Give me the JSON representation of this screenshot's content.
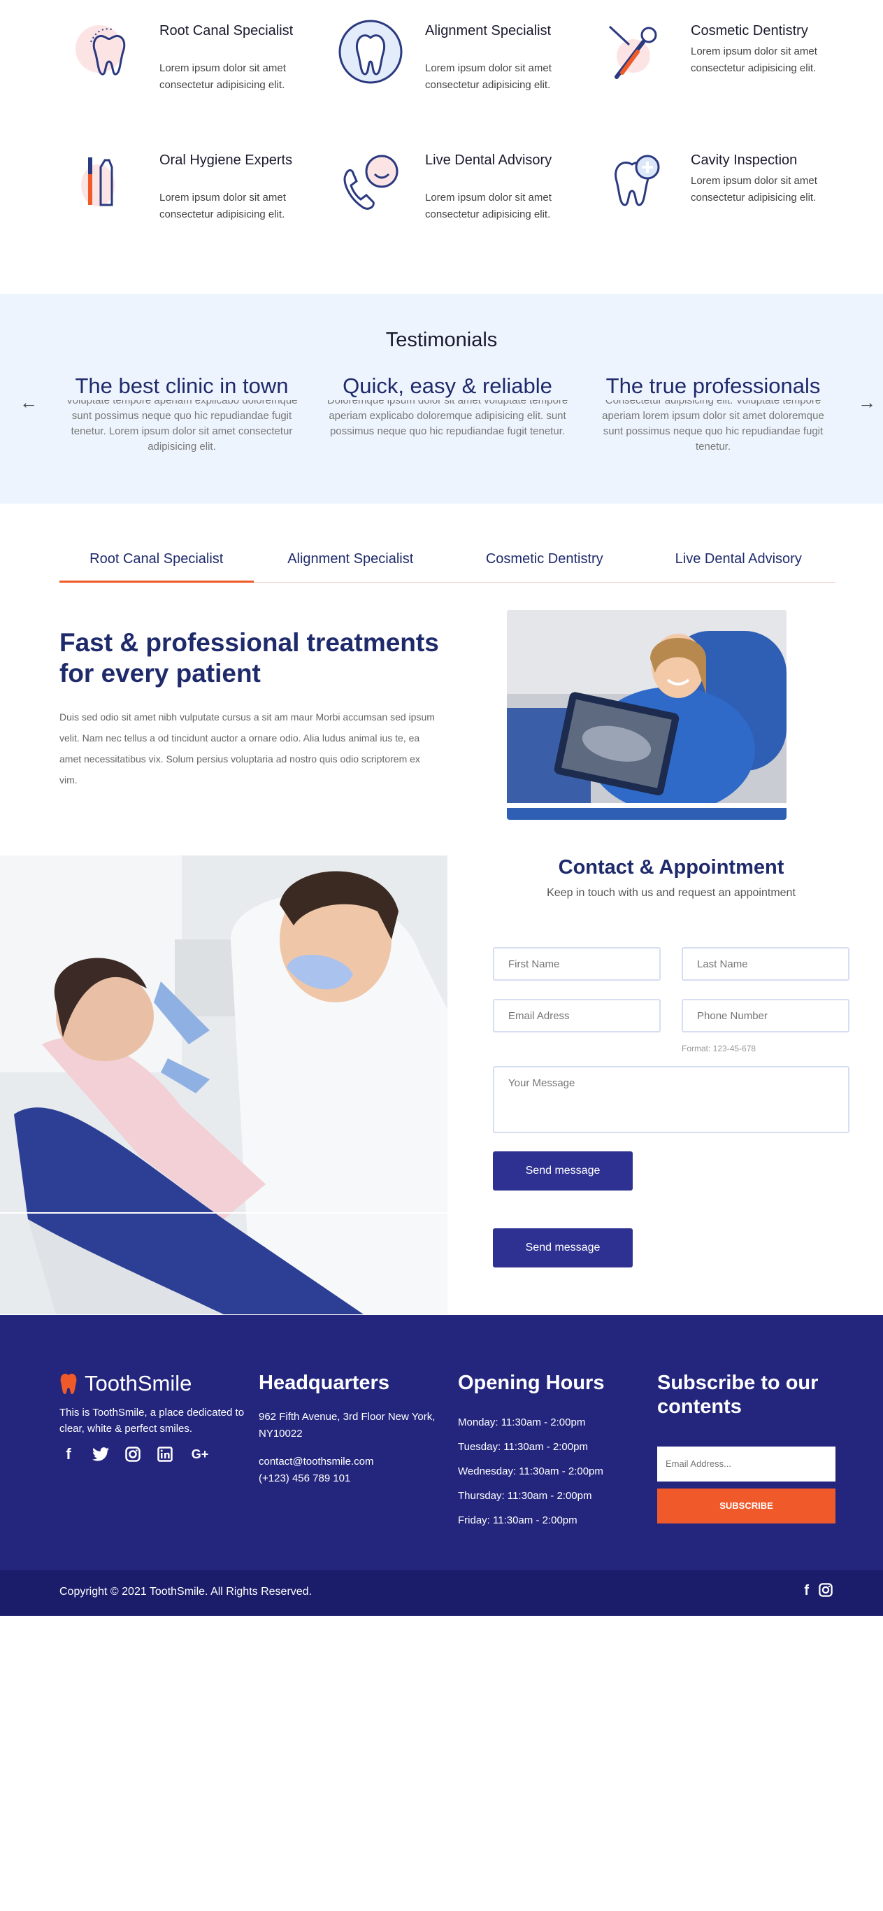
{
  "services": [
    {
      "title": "Root Canal Specialist",
      "desc": "Lorem ipsum dolor sit amet consectetur adipisicing elit.",
      "icon": "root-canal-icon"
    },
    {
      "title": "Alignment Specialist",
      "desc": "Lorem ipsum dolor sit amet consectetur adipisicing elit.",
      "icon": "tooth-alignment-icon"
    },
    {
      "title": "Cosmetic Dentistry",
      "desc": "Lorem ipsum dolor sit amet consectetur adipisicing elit.",
      "icon": "dental-tools-icon"
    },
    {
      "title": "Oral Hygiene Experts",
      "desc": "Lorem ipsum dolor sit amet consectetur adipisicing elit.",
      "icon": "toothbrush-icon"
    },
    {
      "title": "Live Dental Advisory",
      "desc": "Lorem ipsum dolor sit amet consectetur adipisicing elit.",
      "icon": "phone-advisory-icon"
    },
    {
      "title": "Cavity Inspection",
      "desc": "Lorem ipsum dolor sit amet consectetur adipisicing elit.",
      "icon": "tooth-plus-icon"
    }
  ],
  "testimonials": {
    "heading": "Testimonials",
    "items": [
      {
        "title": "The best clinic in town",
        "text": "Voluptate tempore aperiam explicabo doloremque sunt possimus neque quo hic repudiandae fugit tenetur. Lorem ipsum dolor sit amet consectetur adipisicing elit."
      },
      {
        "title": "Quick, easy & reliable",
        "text": "Doloremque ipsum dolor sit amet voluptate tempore aperiam explicabo doloremque adipisicing elit. sunt possimus neque quo hic repudiandae fugit tenetur."
      },
      {
        "title": "The true professionals",
        "text": "Consectetur adipisicing elit. Voluptate tempore aperiam lorem ipsum dolor sit amet doloremque sunt possimus neque quo hic repudiandae fugit tenetur."
      }
    ],
    "prev_arrow": "←",
    "next_arrow": "→"
  },
  "tabs": [
    "Root Canal Specialist",
    "Alignment Specialist",
    "Cosmetic Dentistry",
    "Live Dental Advisory"
  ],
  "feature": {
    "title": "Fast & professional treatments for every patient",
    "text": "Duis sed odio sit amet nibh vulputate cursus a sit am maur Morbi accumsan sed ipsum velit. Nam nec tellus a od tincidunt auctor a ornare odio. Alia ludus animal ius te, ea amet necessitatibus vix. Solum persius voluptaria ad nostro quis odio scriptorem ex vim."
  },
  "contact": {
    "title": "Contact & Appointment",
    "subtitle": "Keep in touch with us and request an appointment",
    "first_name": "First Name",
    "last_name": "Last Name",
    "email": "Email Adress",
    "phone": "Phone Number",
    "phone_hint": "Format: 123-45-678",
    "message": "Your Message",
    "send": "Send message",
    "send2": "Send message"
  },
  "footer": {
    "brand": "ToothSmile",
    "about": "This is ToothSmile, a place dedicated to clear, white & perfect smiles.",
    "hq_title": "Headquarters",
    "address": "962 Fifth Avenue, 3rd Floor New York, NY10022",
    "email": "contact@toothsmile.com",
    "phone": "(+123) 456 789 101",
    "hours_title": "Opening Hours",
    "hours": [
      "Monday: 11:30am - 2:00pm",
      "Tuesday: 11:30am - 2:00pm",
      "Wednesday: 11:30am - 2:00pm",
      "Thursday: 11:30am - 2:00pm",
      "Friday: 11:30am - 2:00pm"
    ],
    "subscribe_title": "Subscribe to our contents",
    "subscribe_placeholder": "Email Address...",
    "subscribe_button": "SUBSCRIBE",
    "copyright": "Copyright © 2021 ToothSmile. All Rights Reserved."
  },
  "colors": {
    "navy": "#1f2a6b",
    "accent": "#f05a28",
    "footer_bg": "#24267e",
    "footer_bottom": "#1b1c6a",
    "testimonial_bg": "#eef4fd",
    "button": "#2e3192"
  }
}
